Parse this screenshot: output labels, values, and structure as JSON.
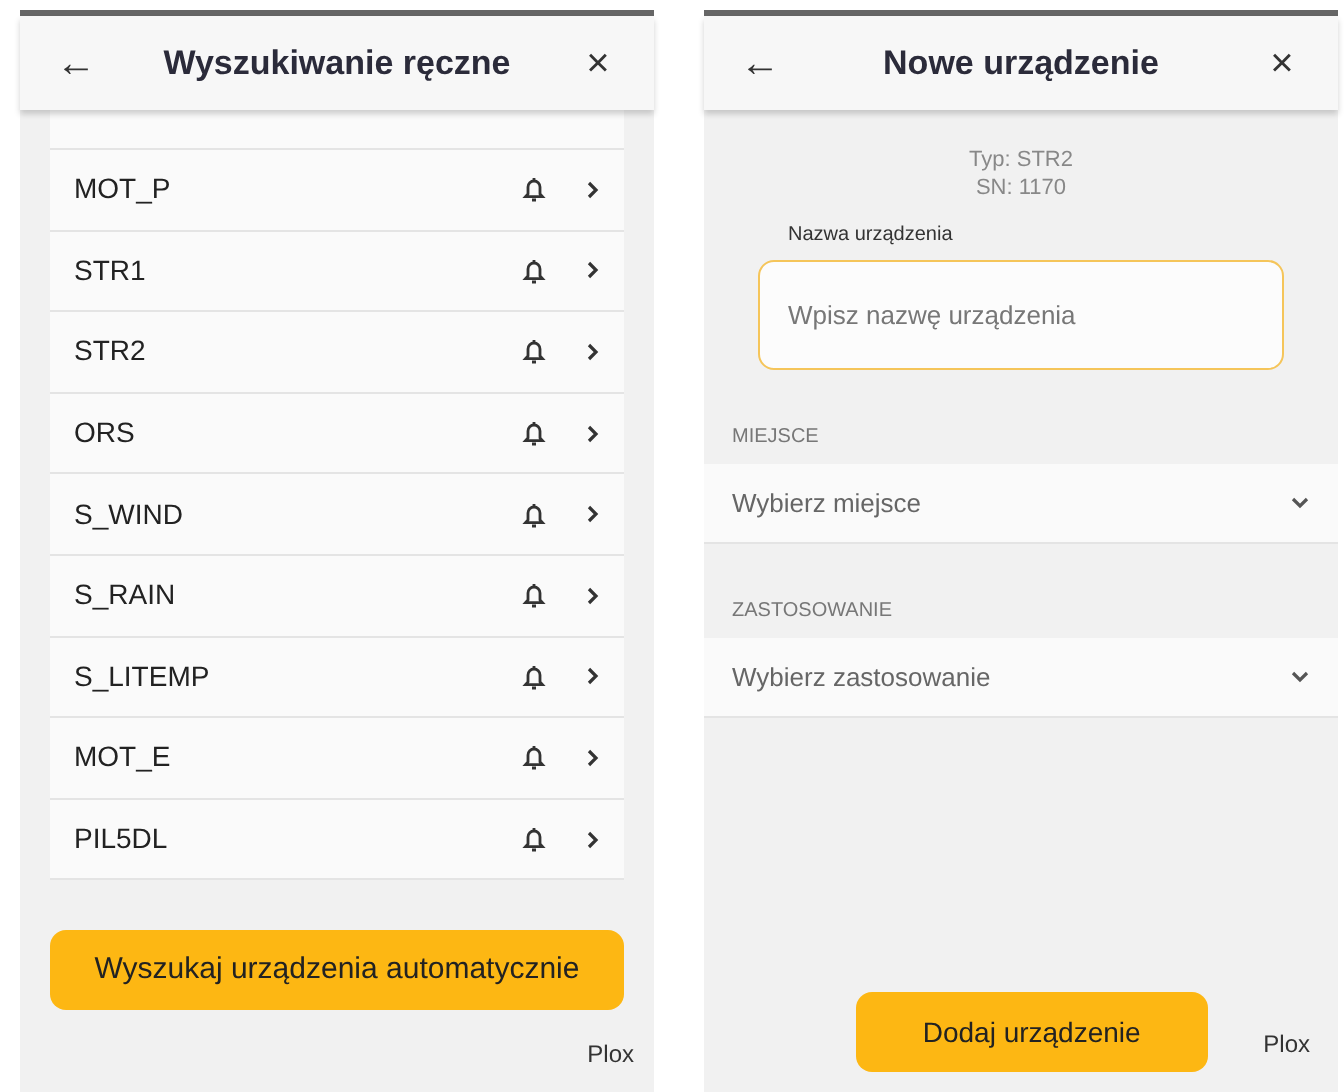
{
  "screens": [
    {
      "kind": "list",
      "header": {
        "back": "←",
        "title": "Wyszukiwanie ręczne",
        "close": "×"
      },
      "devices": [
        {
          "name": "MOT_P"
        },
        {
          "name": "STR1"
        },
        {
          "name": "STR2"
        },
        {
          "name": "ORS"
        },
        {
          "name": "S_WIND"
        },
        {
          "name": "S_RAIN"
        },
        {
          "name": "S_LITEMP"
        },
        {
          "name": "MOT_E"
        },
        {
          "name": "PIL5DL"
        }
      ],
      "button": "Wyszukaj urządzenia automatycznie",
      "footer": "Plox"
    },
    {
      "kind": "form",
      "header": {
        "back": "←",
        "title": "Nowe urządzenie",
        "close": "×"
      },
      "type_line": "Typ: STR2",
      "sn_line": "SN: 1170",
      "name_field": {
        "label": "Nazwa urządzenia",
        "placeholder": "Wpisz nazwę urządzenia"
      },
      "selects": [
        {
          "section": "MIEJSCE",
          "placeholder": "Wybierz miejsce"
        },
        {
          "section": "ZASTOSOWANIE",
          "placeholder": "Wybierz zastosowanie"
        }
      ],
      "button": "Dodaj urządzenie",
      "footer": "Plox"
    }
  ]
}
